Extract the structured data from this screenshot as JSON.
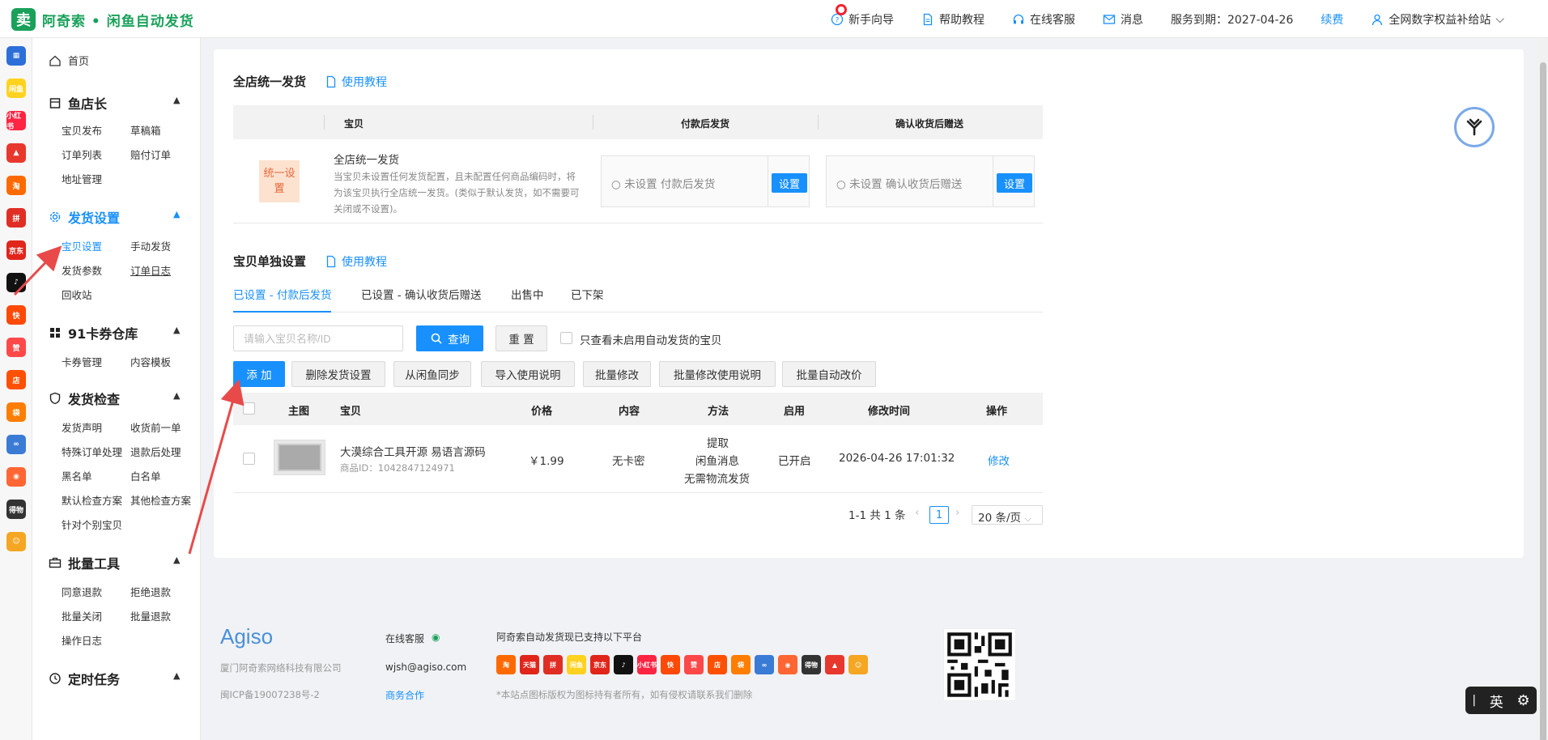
{
  "header": {
    "brand": "阿奇索 • 闲鱼自动发货",
    "guide": "新手向导",
    "help": "帮助教程",
    "service": "在线客服",
    "messages": "消息",
    "expiry": "服务到期：2027-04-26",
    "renew": "续费",
    "account": "全网数字权益补给站"
  },
  "apps": [
    {
      "label": "▦",
      "color": "#2d6fd8"
    },
    {
      "label": "闲鱼",
      "color": "#ffd21f"
    },
    {
      "label": "小红书",
      "color": "#ff2442"
    },
    {
      "label": "▲",
      "color": "#e8382e"
    },
    {
      "label": "淘",
      "color": "#ff6a00"
    },
    {
      "label": "拼",
      "color": "#e02e24"
    },
    {
      "label": "京东",
      "color": "#e1251b"
    },
    {
      "label": "♪",
      "color": "#111111"
    },
    {
      "label": "快",
      "color": "#ff4906"
    },
    {
      "label": "赞",
      "color": "#ff4949"
    },
    {
      "label": "店",
      "color": "#ff5000"
    },
    {
      "label": "袋",
      "color": "#ff7e00"
    },
    {
      "label": "∞",
      "color": "#3a7bd5"
    },
    {
      "label": "◉",
      "color": "#ff6633"
    },
    {
      "label": "得物",
      "color": "#333333"
    },
    {
      "label": "☺",
      "color": "#f5a623"
    }
  ],
  "sidebar": {
    "home": "首页",
    "groups": [
      {
        "title": "鱼店长",
        "items": [
          "宝贝发布",
          "草稿箱",
          "订单列表",
          "赔付订单",
          "地址管理"
        ]
      },
      {
        "title": "发货设置",
        "items": [
          "宝贝设置",
          "手动发货",
          "发货参数",
          "订单日志",
          "回收站"
        ]
      },
      {
        "title": "91卡券仓库",
        "items": [
          "卡券管理",
          "内容模板"
        ]
      },
      {
        "title": "发货检查",
        "items": [
          "发货声明",
          "收货前一单",
          "特殊订单处理",
          "退款后处理",
          "黑名单",
          "白名单",
          "默认检查方案",
          "其他检查方案",
          "针对个别宝贝"
        ]
      },
      {
        "title": "批量工具",
        "items": [
          "同意退款",
          "拒绝退款",
          "批量关闭",
          "批量退款",
          "操作日志"
        ]
      },
      {
        "title": "定时任务",
        "items": []
      }
    ]
  },
  "unified": {
    "title": "全店统一发货",
    "tutorial": "使用教程",
    "col_item": "宝贝",
    "col_after_pay": "付款后发货",
    "col_after_confirm": "确认收货后赠送",
    "badge": "统一设置",
    "row_title": "全店统一发货",
    "row_desc": "当宝贝未设置任何发货配置，且未配置任何商品编码时，将为该宝贝执行全店统一发货。(类似于默认发货，如不需要可关闭或不设置)。",
    "after_pay_status": "○ 未设置 付款后发货",
    "after_confirm_status": "○ 未设置 确认收货后赠送",
    "set_label": "设置"
  },
  "individual": {
    "title": "宝贝单独设置",
    "tutorial": "使用教程",
    "tabs": [
      "已设置 - 付款后发货",
      "已设置 - 确认收货后赠送",
      "出售中",
      "已下架"
    ],
    "search_placeholder": "请输入宝贝名称/ID",
    "query_label": "查询",
    "reset_label": "重 置",
    "only_disabled": "只查看未启用自动发货的宝贝",
    "actions": [
      "添 加",
      "删除发货设置",
      "从闲鱼同步",
      "导入使用说明",
      "批量修改",
      "批量修改使用说明",
      "批量自动改价"
    ],
    "columns": [
      "主图",
      "宝贝",
      "价格",
      "内容",
      "方法",
      "启用",
      "修改时间",
      "操作"
    ],
    "rows": [
      {
        "name": "大漠综合工具开源 易语言源码",
        "item_id": "商品ID：1042847124971",
        "price": "￥1.99",
        "content": "无卡密",
        "method": [
          "提取",
          "闲鱼消息",
          "无需物流发货"
        ],
        "enabled": "已开启",
        "modified": "2026-04-26 17:01:32",
        "action": "修改"
      }
    ],
    "pagination": {
      "summary": "1-1 共 1 条",
      "current": "1",
      "page_size": "20 条/页"
    }
  },
  "footer": {
    "brand": "Agiso",
    "company": "厦门阿奇索网络科技有限公司",
    "icp": "闽ICP备19007238号-2",
    "service": "在线客服",
    "email": "wjsh@agiso.com",
    "business": "商务合作",
    "platforms_title": "阿奇索自动发货现已支持以下平台",
    "disclaimer": "*本站点图标版权为图标持有者所有，如有侵权请联系我们删除",
    "platforms": [
      {
        "label": "淘",
        "color": "#ff6a00"
      },
      {
        "label": "天猫",
        "color": "#e1251b"
      },
      {
        "label": "拼",
        "color": "#e02e24"
      },
      {
        "label": "闲鱼",
        "color": "#ffd21f"
      },
      {
        "label": "京东",
        "color": "#e1251b"
      },
      {
        "label": "♪",
        "color": "#111111"
      },
      {
        "label": "小红书",
        "color": "#ff2442"
      },
      {
        "label": "快",
        "color": "#ff4906"
      },
      {
        "label": "赞",
        "color": "#ff4949"
      },
      {
        "label": "店",
        "color": "#ff5000"
      },
      {
        "label": "袋",
        "color": "#ff7e00"
      },
      {
        "label": "∞",
        "color": "#3a7bd5"
      },
      {
        "label": "◉",
        "color": "#ff6633"
      },
      {
        "label": "得物",
        "color": "#333333"
      },
      {
        "label": "▲",
        "color": "#e8382e"
      },
      {
        "label": "☺",
        "color": "#f5a623"
      }
    ]
  },
  "ime": {
    "lang": "英"
  },
  "colors": {
    "primary": "#1890ff",
    "brand": "#19a15a",
    "annotation_arrow": "#e84a4a"
  }
}
